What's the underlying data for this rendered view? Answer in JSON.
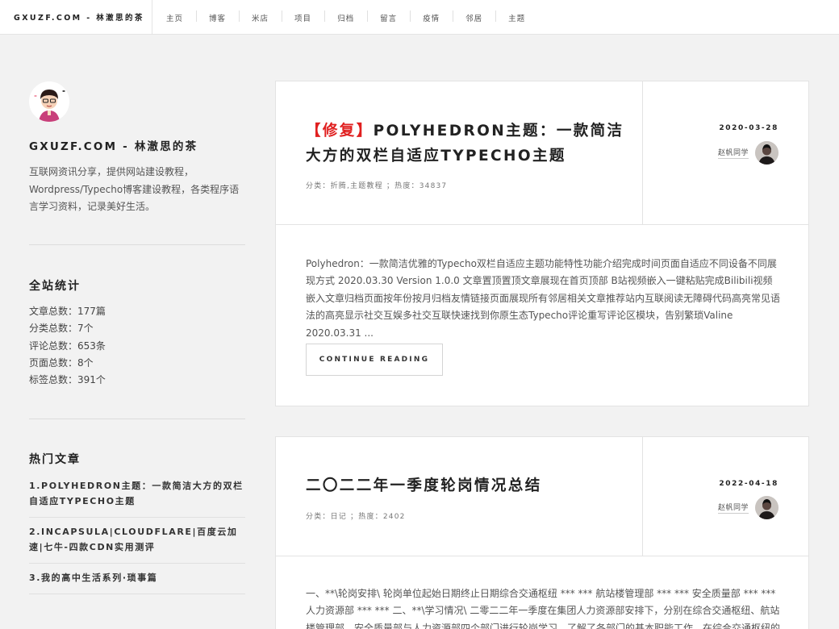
{
  "header": {
    "site_title": "GXUZF.COM - 林澈思的茶",
    "nav": [
      "主页",
      "博客",
      "米店",
      "项目",
      "归档",
      "留言",
      "疫情",
      "邻居",
      "主题"
    ]
  },
  "sidebar": {
    "site_name": "GXUZF.COM - 林澈思的茶",
    "description": "互联网资讯分享，提供网站建设教程，Wordpress/Typecho博客建设教程，各类程序语言学习资料，记录美好生活。",
    "stats_title": "全站统计",
    "stats": [
      "文章总数：177篇",
      "分类总数：7个",
      "评论总数：653条",
      "页面总数：8个",
      "标签总数：391个"
    ],
    "hot_title": "热门文章",
    "hot": [
      "1.POLYHEDRON主题：一款简洁大方的双栏自适应TYPECHO主题",
      "2.INCAPSULA|CLOUDFLARE|百度云加速|七牛-四款CDN实用测评",
      "3.我的高中生活系列·琐事篇"
    ]
  },
  "posts": [
    {
      "title_tag": "【修复】",
      "title": "POLYHEDRON主题：一款简洁大方的双栏自适应TYPECHO主题",
      "meta": "分类：折腾,主题教程 ；热度：34837",
      "date": "2020-03-28",
      "author": "赵帆同学",
      "excerpt": "Polyhedron：一款简洁优雅的Typecho双栏自适应主题功能特性功能介绍完成时间页面自适应不同设备不同展现方式 2020.03.30 Version 1.0.0 文章置顶置顶文章展现在首页顶部 B站视频嵌入一键粘贴完成Bilibili视频嵌入文章归档页面按年份按月归档友情链接页面展现所有邻居相关文章推荐站内互联阅读无障碍代码高亮常见语法的高亮显示社交互娱多社交互联快速找到你原生态Typecho评论重写评论区模块，告别繁琐Valine 2020.03.31 ...",
      "read_more": "CONTINUE READING"
    },
    {
      "title": "二〇二二年一季度轮岗情况总结",
      "meta": "分类：日记 ；热度：2402",
      "date": "2022-04-18",
      "author": "赵帆同学",
      "excerpt": "一、**\\轮岗安排\\ 轮岗单位起始日期终止日期综合交通枢纽 *** *** 航站楼管理部 *** *** 安全质量部 *** *** 人力资源部 *** *** 二、**\\学习情况\\ 二零二二年一季度在集团人力资源部安排下，分别在综合交通枢纽、航站楼管理部、安全质量部与人力资源部四个部门进行轮岗学习，了解了各部门的基本职能工作，在综合交通枢纽的学习..."
    }
  ]
}
